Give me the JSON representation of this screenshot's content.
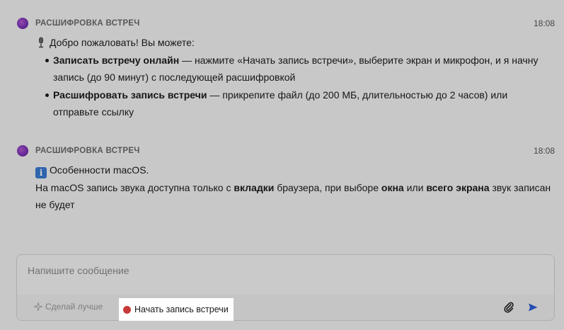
{
  "messages": [
    {
      "sender": "РАСШИФРОВКА ВСТРЕЧ",
      "time": "18:08",
      "intro": "Добро пожаловать! Вы можете:",
      "intro_icon": "microphone-icon",
      "items": [
        {
          "bold": "Записать встречу онлайн",
          "text": " — нажмите «Начать запись встречи», выберите экран и микрофон, и я начну запись (до 90 минут) с последующей расшифровкой"
        },
        {
          "bold": "Расшифровать запись встречи",
          "text": " — прикрепите файл (до 200 МБ, длительностью до 2 часов) или отправьте ссылку"
        }
      ]
    },
    {
      "sender": "РАСШИФРОВКА ВСТРЕЧ",
      "time": "18:08",
      "title": "Особенности macOS.",
      "title_icon": "info-icon",
      "p1": "На macOS запись звука доступна только с ",
      "b1": "вкладки",
      "p2": " браузера, при выборе ",
      "b2": "окна",
      "p3": " или ",
      "b3": "всего экрана",
      "p4": " звук записан не будет"
    }
  ],
  "composer": {
    "placeholder": "Напишите сообщение",
    "improve_label": "Сделай лучше",
    "record_label": "Начать запись встречи"
  },
  "colors": {
    "record_dot": "#c83a3a",
    "send_arrow": "#2b5fd9",
    "avatar": "#7a2fb4"
  }
}
